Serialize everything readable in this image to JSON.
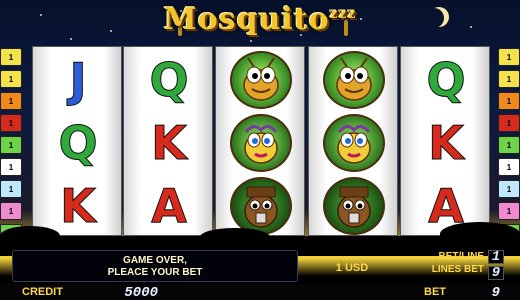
{
  "game": {
    "title": "Mosquito",
    "title_suffix": "zzz"
  },
  "paylines": {
    "left": [
      "1",
      "1",
      "1",
      "1",
      "1",
      "1",
      "1",
      "1",
      "1"
    ],
    "right": [
      "1",
      "1",
      "1",
      "1",
      "1",
      "1",
      "1",
      "1",
      "1"
    ],
    "colors": [
      "#f5e14a",
      "#f5e14a",
      "#f08a1c",
      "#d62a1c",
      "#6fd34a",
      "#ffffff",
      "#bfe8ff",
      "#f08ad0",
      "#6fd34a"
    ]
  },
  "reels": [
    [
      "J",
      "Q",
      "K"
    ],
    [
      "Q",
      "K",
      "A"
    ],
    [
      "mosquito-yellow",
      "mosquito-girl",
      "mosquito-brown"
    ],
    [
      "mosquito-yellow",
      "mosquito-girl",
      "mosquito-brown"
    ],
    [
      "Q",
      "K",
      "A"
    ]
  ],
  "message": {
    "line1": "GAME OVER,",
    "line2": "PLEACE YOUR BET"
  },
  "denomination": "1 USD",
  "bet_per_line": {
    "label": "BET/LINE",
    "value": "1"
  },
  "lines_bet": {
    "label": "LINES BET",
    "value": "9"
  },
  "credit": {
    "label": "CREDIT",
    "value": "5000"
  },
  "bet": {
    "label": "BET",
    "value": "9"
  }
}
